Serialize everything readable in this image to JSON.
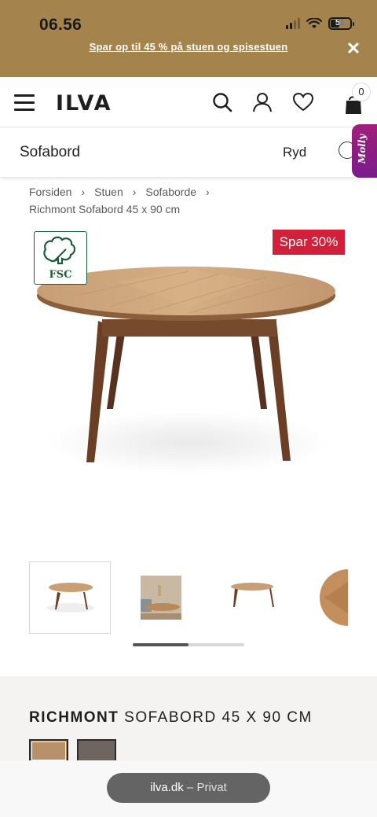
{
  "status_bar": {
    "time": "06.56",
    "battery": "51"
  },
  "promo": {
    "text": "Spar op til 45 % på stuen og spisestuen"
  },
  "header": {
    "logo": "ILVA",
    "cart_count": "0"
  },
  "search": {
    "query": "Sofabord",
    "clear_label": "Ryd",
    "assistant_label": "Molly"
  },
  "breadcrumb": {
    "items": [
      "Forsiden",
      "Stuen",
      "Sofaborde"
    ],
    "current": "Richmont Sofabord 45 x 90 cm"
  },
  "product": {
    "certification": "FSC",
    "discount_badge": "Spar 30%",
    "title_bold": "RICHMONT",
    "title_rest": "SOFABORD 45 X 90 CM",
    "swatches": [
      {
        "color": "#b8916a",
        "selected": true
      },
      {
        "color": "#6e6560",
        "selected": false
      }
    ]
  },
  "gallery": {
    "active_index": 0,
    "thumb_count": 4
  },
  "browser": {
    "domain": "ilva.dk",
    "mode": "Privat"
  },
  "colors": {
    "brand_band": "#a4834c",
    "sale_red": "#d2203b",
    "fsc_green": "#1c5b3a"
  }
}
